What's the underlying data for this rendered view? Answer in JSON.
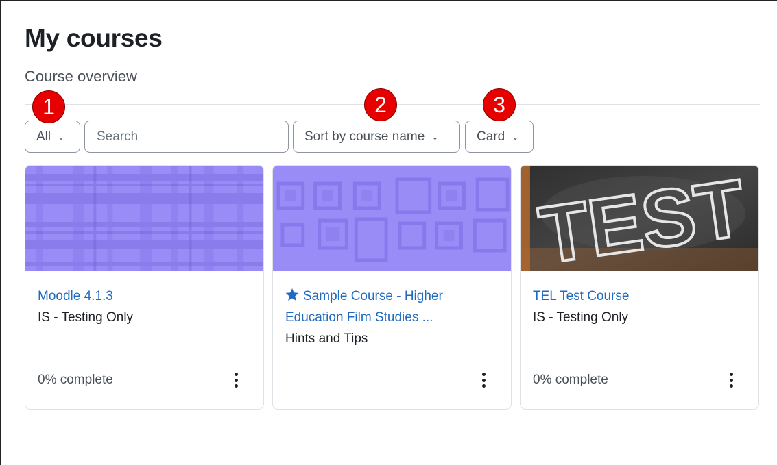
{
  "page": {
    "title": "My courses",
    "section_title": "Course overview"
  },
  "controls": {
    "filter_label": "All",
    "search_placeholder": "Search",
    "sort_label": "Sort by course name",
    "view_label": "Card"
  },
  "annotations": [
    "1",
    "2",
    "3"
  ],
  "courses": [
    {
      "name": "Moodle 4.1.3",
      "category": "IS - Testing Only",
      "progress": "0% complete",
      "starred": false,
      "image": "purple-plaid-pattern"
    },
    {
      "name_line1": "Sample Course - Higher",
      "name_line2": "Education Film Studies ...",
      "category": "Hints and Tips",
      "starred": true,
      "image": "purple-squares-pattern"
    },
    {
      "name": "TEL Test Course",
      "category": "IS - Testing Only",
      "progress": "0% complete",
      "starred": false,
      "image": "chalkboard-test-image",
      "image_text": "TEST"
    }
  ],
  "colors": {
    "link": "#1f6bc0",
    "badge": "#e60000",
    "pattern_purple": "#9a8cf7",
    "chalkboard": "#3a3a3a"
  }
}
